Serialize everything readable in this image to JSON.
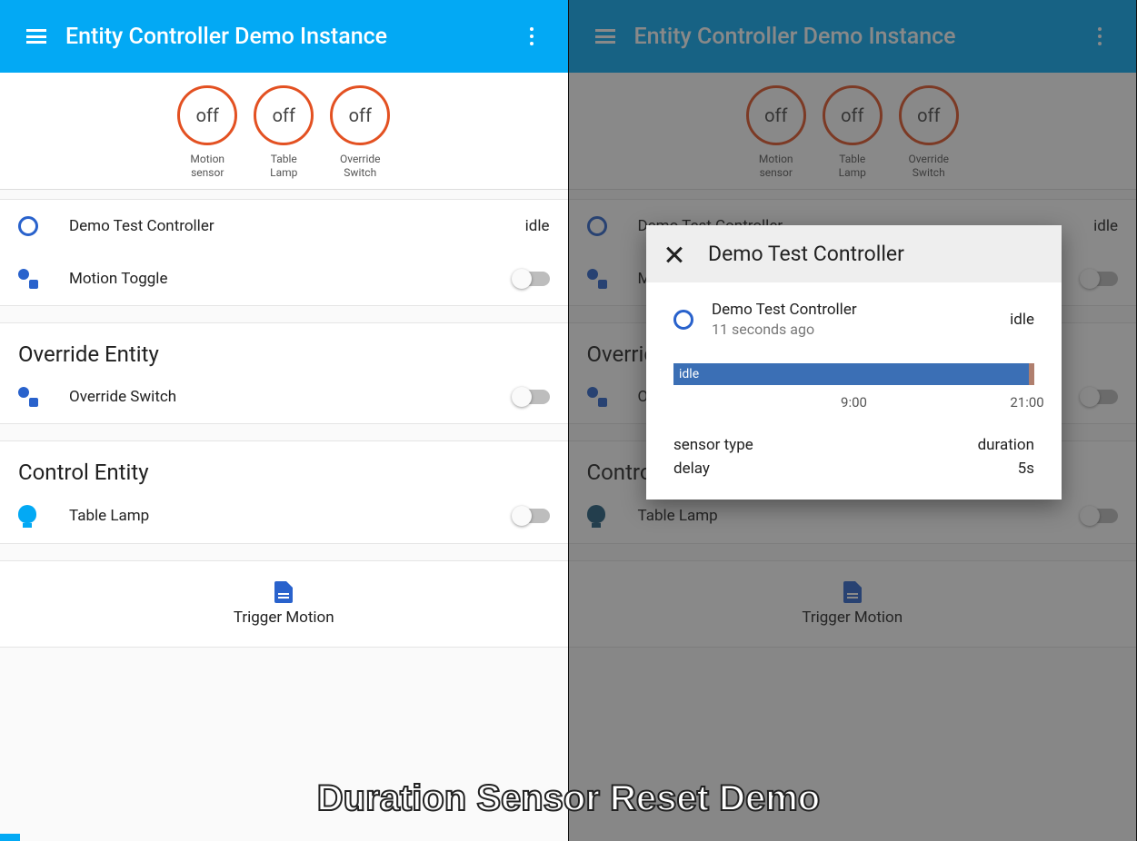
{
  "header": {
    "title": "Entity Controller Demo Instance"
  },
  "gauges": [
    {
      "value": "off",
      "label": "Motion\nsensor"
    },
    {
      "value": "off",
      "label": "Table\nLamp"
    },
    {
      "value": "off",
      "label": "Override\nSwitch"
    }
  ],
  "main_card": {
    "controller": {
      "label": "Demo Test Controller",
      "state": "idle"
    },
    "motion_toggle": {
      "label": "Motion Toggle"
    }
  },
  "override_card": {
    "title": "Override Entity",
    "switch": {
      "label": "Override Switch"
    }
  },
  "control_card": {
    "title": "Control Entity",
    "lamp": {
      "label": "Table Lamp"
    }
  },
  "script": {
    "label": "Trigger Motion"
  },
  "dialog": {
    "title": "Demo Test Controller",
    "entity": {
      "name": "Demo Test Controller",
      "time": "11 seconds ago",
      "state": "idle"
    },
    "history": {
      "state_label": "idle",
      "ticks": [
        "9:00",
        "21:00"
      ]
    },
    "attrs": [
      {
        "k": "sensor type",
        "v": "duration"
      },
      {
        "k": "delay",
        "v": "5s"
      }
    ]
  },
  "caption": "Duration Sensor Reset Demo"
}
